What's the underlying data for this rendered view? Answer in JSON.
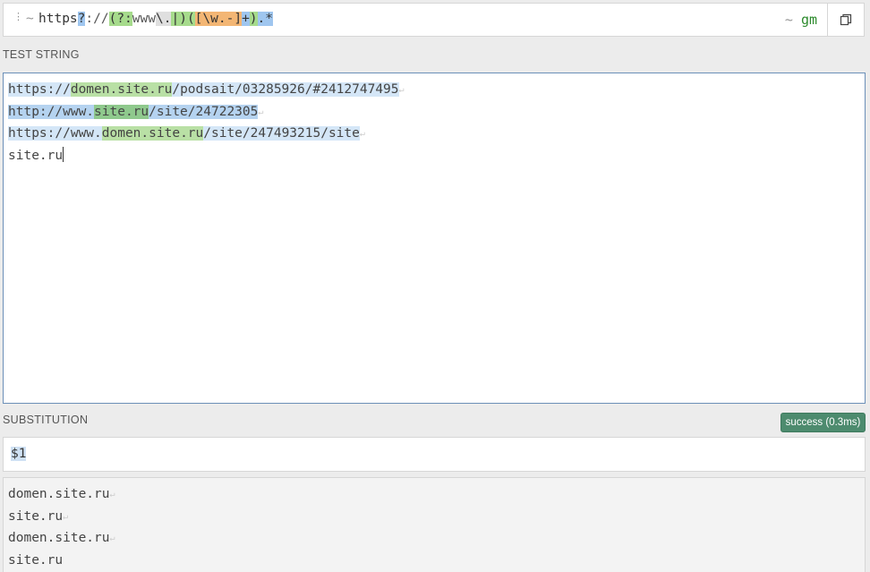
{
  "regex": {
    "delimiter_open": "~",
    "pattern_tokens": [
      {
        "text": "https",
        "cls": "tok-lit"
      },
      {
        "text": "?",
        "cls": "tok-quant"
      },
      {
        "text": "://",
        "cls": "tok-dim"
      },
      {
        "text": "(?:",
        "cls": "tok-grp"
      },
      {
        "text": "www",
        "cls": "tok-dim"
      },
      {
        "text": "\\.",
        "cls": "tok-esc"
      },
      {
        "text": "|)",
        "cls": "tok-alt"
      },
      {
        "text": "(",
        "cls": "tok-grp"
      },
      {
        "text": "[\\w.-]",
        "cls": "tok-set"
      },
      {
        "text": "+",
        "cls": "tok-quant"
      },
      {
        "text": ")",
        "cls": "tok-grp"
      },
      {
        "text": ".*",
        "cls": "tok-quant"
      }
    ],
    "delimiter_close": "~",
    "flags": "gm",
    "drag_icon": "vertical-dots-icon",
    "copy_icon": "copy-icon"
  },
  "test_string": {
    "label": "TEST STRING",
    "lines": [
      [
        {
          "text": "https://",
          "cls": "m1"
        },
        {
          "text": "domen.site.ru",
          "cls": "g1"
        },
        {
          "text": "/podsait/03285926/#2412747495",
          "cls": "m1"
        }
      ],
      [
        {
          "text": "http://www.",
          "cls": "m2"
        },
        {
          "text": "site.ru",
          "cls": "g2"
        },
        {
          "text": "/site/24722305",
          "cls": "m2"
        }
      ],
      [
        {
          "text": "https://www.",
          "cls": "m1"
        },
        {
          "text": "domen.site.ru",
          "cls": "g1"
        },
        {
          "text": "/site/247493215/site",
          "cls": "m1"
        }
      ],
      [
        {
          "text": "site.ru",
          "cls": ""
        }
      ]
    ]
  },
  "substitution": {
    "label": "SUBSTITUTION",
    "status": "success (0.3ms)",
    "value": "$1",
    "result_lines": [
      "domen.site.ru",
      "site.ru",
      "domen.site.ru",
      "site.ru"
    ]
  },
  "colors": {
    "match_light": "#d4e6f7",
    "match_dark": "#b5d3f0",
    "group_light": "#b9e0a5",
    "group_dark": "#8fc98d",
    "success": "#4d8b6e"
  }
}
